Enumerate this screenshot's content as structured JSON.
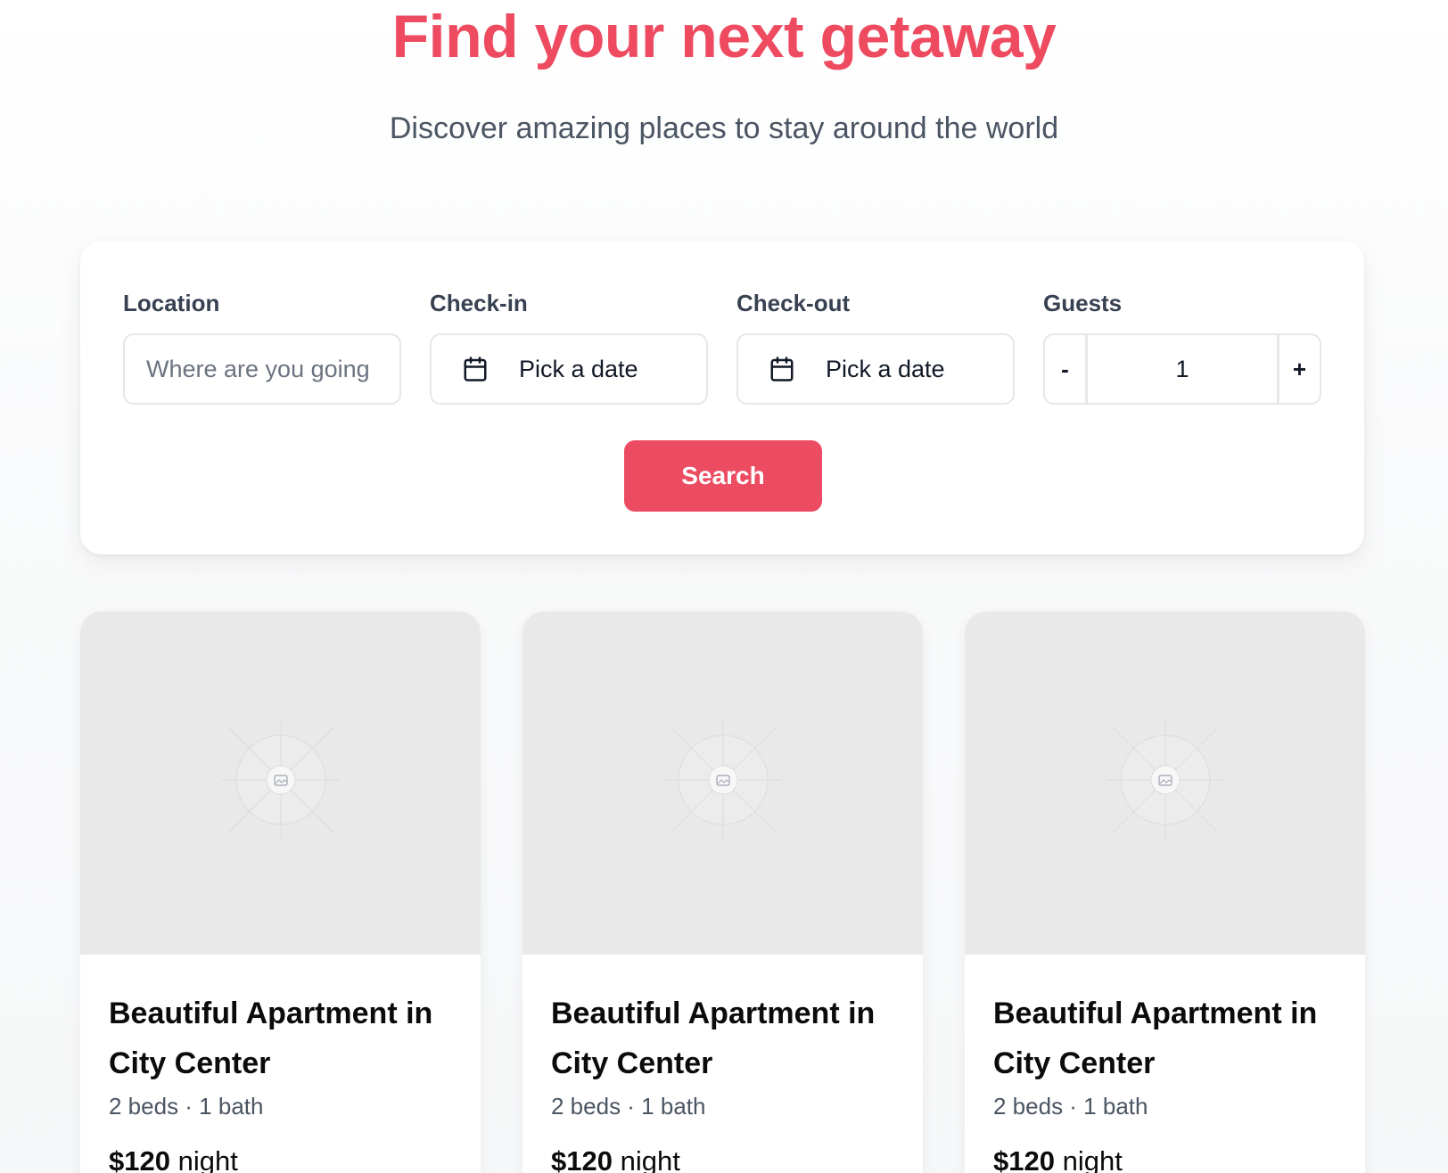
{
  "hero": {
    "title": "Find your next getaway",
    "subtitle": "Discover amazing places to stay around the world"
  },
  "search": {
    "location_label": "Location",
    "location_placeholder": "Where are you going",
    "checkin_label": "Check-in",
    "checkin_value": "Pick a date",
    "checkout_label": "Check-out",
    "checkout_value": "Pick a date",
    "guests_label": "Guests",
    "guests_minus": "-",
    "guests_value": "1",
    "guests_plus": "+",
    "button_label": "Search"
  },
  "listings": [
    {
      "title": "Beautiful Apartment in City Center",
      "meta": "2 beds · 1 bath",
      "price": "$120",
      "unit": "night"
    },
    {
      "title": "Beautiful Apartment in City Center",
      "meta": "2 beds · 1 bath",
      "price": "$120",
      "unit": "night"
    },
    {
      "title": "Beautiful Apartment in City Center",
      "meta": "2 beds · 1 bath",
      "price": "$120",
      "unit": "night"
    }
  ],
  "icons": {
    "date_picker": "calendar-icon",
    "listing_image": "image-placeholder-icon"
  },
  "colors": {
    "accent": "#ec4c62",
    "title": "#ee4b61",
    "image_placeholder": "#e9e9e9"
  }
}
